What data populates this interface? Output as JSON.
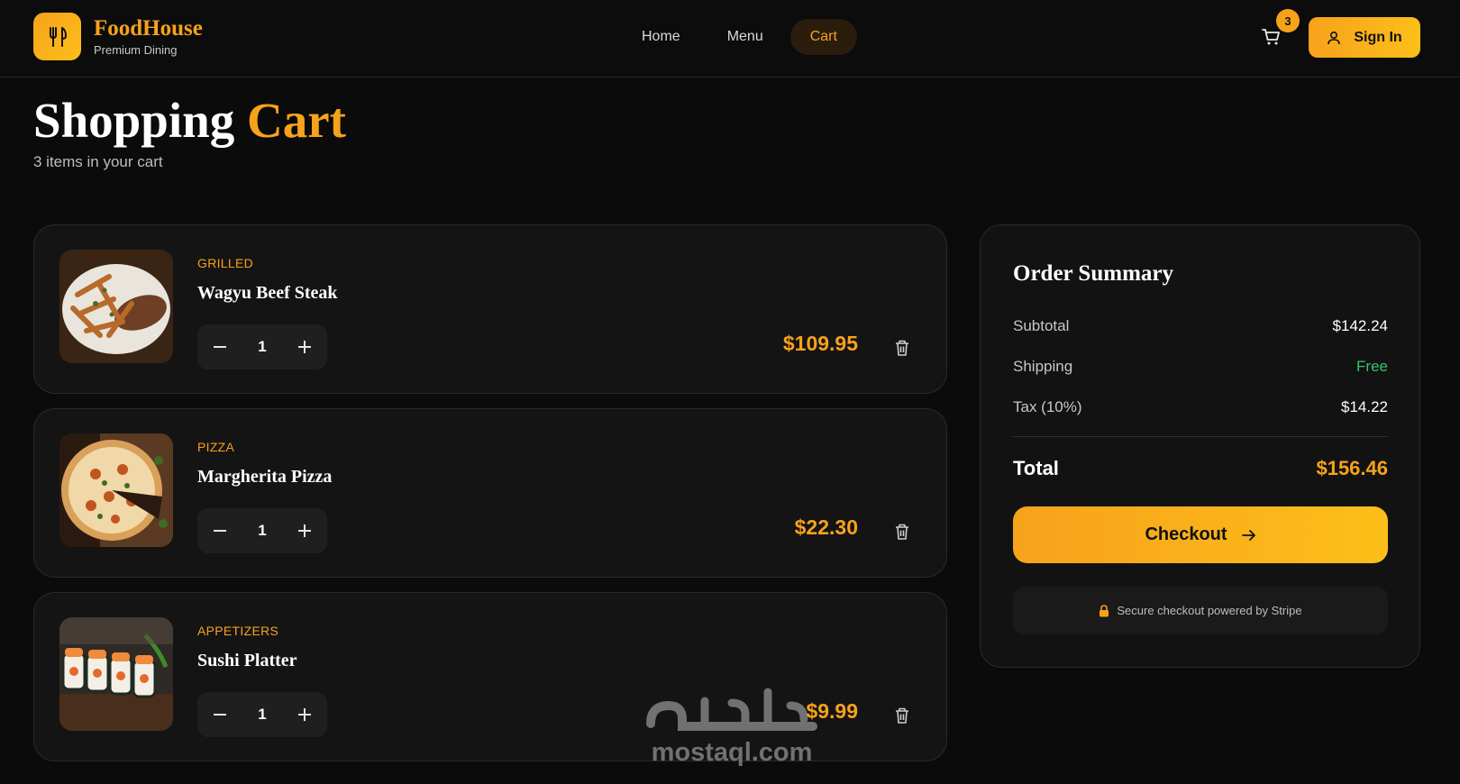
{
  "brand": {
    "name": "FoodHouse",
    "tagline": "Premium Dining",
    "accent": "#f7a21b",
    "icon": "fork-knife-icon"
  },
  "nav": {
    "items": [
      {
        "label": "Home"
      },
      {
        "label": "Menu"
      },
      {
        "label": "Cart",
        "active": true
      }
    ]
  },
  "header": {
    "cart_count": "3",
    "signin_label": "Sign In"
  },
  "page": {
    "title_main": "Shopping",
    "title_accent": "Cart",
    "subtitle": "3 items in your cart"
  },
  "cart": {
    "items": [
      {
        "category": "GRILLED",
        "name": "Wagyu Beef Steak",
        "quantity": "1",
        "price": "$109.95",
        "image": "steak-photo"
      },
      {
        "category": "PIZZA",
        "name": "Margherita Pizza",
        "quantity": "1",
        "price": "$22.30",
        "image": "pizza-photo"
      },
      {
        "category": "APPETIZERS",
        "name": "Sushi Platter",
        "quantity": "1",
        "price": "$9.99",
        "image": "sushi-photo"
      }
    ]
  },
  "summary": {
    "title": "Order Summary",
    "rows": [
      {
        "label": "Subtotal",
        "value": "$142.24"
      },
      {
        "label": "Shipping",
        "value": "Free",
        "color": "#34c56b"
      },
      {
        "label": "Tax (10%)",
        "value": "$14.22"
      }
    ],
    "total_label": "Total",
    "total_value": "$156.46",
    "checkout_label": "Checkout",
    "secure_text": "Secure checkout powered by Stripe"
  },
  "watermark": {
    "text": "mostaql.com"
  }
}
